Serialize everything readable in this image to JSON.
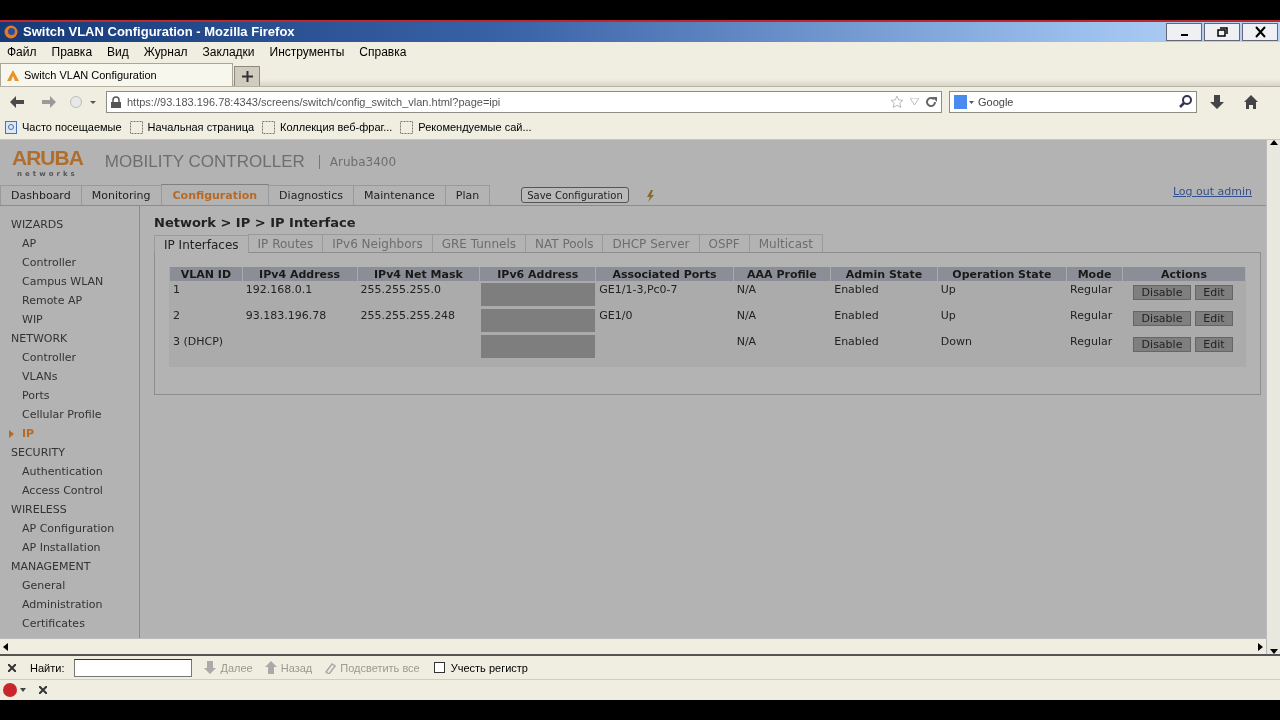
{
  "window": {
    "title": "Switch VLAN Configuration - Mozilla Firefox"
  },
  "menu_bar": [
    "Файл",
    "Правка",
    "Вид",
    "Журнал",
    "Закладки",
    "Инструменты",
    "Справка"
  ],
  "browser_tabs": [
    {
      "label": "Switch VLAN Configuration",
      "selected": true
    }
  ],
  "address_bar": {
    "url": "https://93.183.196.78:4343/screens/switch/config_switch_vlan.html?page=ipi"
  },
  "search_bar": {
    "placeholder": "Google"
  },
  "bookmarks": [
    "Часто посещаемые",
    "Начальная страница",
    "Коллекция веб-фраг...",
    "Рекомендуемые сай..."
  ],
  "app": {
    "logo": "ARUBA",
    "logo_tagline": "networks",
    "product": "MOBILITY CONTROLLER",
    "device": "Aruba3400",
    "nav_tabs": [
      {
        "label": "Dashboard",
        "selected": false
      },
      {
        "label": "Monitoring",
        "selected": false
      },
      {
        "label": "Configuration",
        "selected": true
      },
      {
        "label": "Diagnostics",
        "selected": false
      },
      {
        "label": "Maintenance",
        "selected": false
      },
      {
        "label": "Plan",
        "selected": false
      }
    ],
    "save_button": "Save Configuration",
    "logout_link": "Log out admin",
    "sidebar": {
      "sections": [
        {
          "title": "WIZARDS",
          "items": [
            {
              "label": "AP",
              "selected": false
            },
            {
              "label": "Controller",
              "selected": false
            },
            {
              "label": "Campus WLAN",
              "selected": false
            },
            {
              "label": "Remote AP",
              "selected": false
            },
            {
              "label": "WIP",
              "selected": false
            }
          ]
        },
        {
          "title": "NETWORK",
          "items": [
            {
              "label": "Controller",
              "selected": false
            },
            {
              "label": "VLANs",
              "selected": false
            },
            {
              "label": "Ports",
              "selected": false
            },
            {
              "label": "Cellular Profile",
              "selected": false
            },
            {
              "label": "IP",
              "selected": true
            }
          ]
        },
        {
          "title": "SECURITY",
          "items": [
            {
              "label": "Authentication",
              "selected": false
            },
            {
              "label": "Access Control",
              "selected": false
            }
          ]
        },
        {
          "title": "WIRELESS",
          "items": [
            {
              "label": "AP Configuration",
              "selected": false
            },
            {
              "label": "AP Installation",
              "selected": false
            }
          ]
        },
        {
          "title": "MANAGEMENT",
          "items": [
            {
              "label": "General",
              "selected": false
            },
            {
              "label": "Administration",
              "selected": false
            },
            {
              "label": "Certificates",
              "selected": false
            }
          ]
        }
      ]
    },
    "breadcrumb": "Network > IP > IP Interface",
    "sub_tabs": [
      {
        "label": "IP Interfaces",
        "selected": true
      },
      {
        "label": "IP Routes",
        "selected": false
      },
      {
        "label": "IPv6 Neighbors",
        "selected": false
      },
      {
        "label": "GRE Tunnels",
        "selected": false
      },
      {
        "label": "NAT Pools",
        "selected": false
      },
      {
        "label": "DHCP Server",
        "selected": false
      },
      {
        "label": "OSPF",
        "selected": false
      },
      {
        "label": "Multicast",
        "selected": false
      }
    ],
    "table": {
      "columns": [
        "VLAN ID",
        "IPv4 Address",
        "IPv4 Net Mask",
        "IPv6 Address",
        "Associated Ports",
        "AAA Profile",
        "Admin State",
        "Operation State",
        "Mode",
        "Actions"
      ],
      "rows": [
        {
          "vlan_id": "1",
          "ipv4_address": "192.168.0.1",
          "ipv4_net_mask": "255.255.255.0",
          "associated_ports": "GE1/1-3,Pc0-7",
          "aaa_profile": "N/A",
          "admin_state": "Enabled",
          "operation_state": "Up",
          "mode": "Regular",
          "actions": [
            "Disable",
            "Edit"
          ]
        },
        {
          "vlan_id": "2",
          "ipv4_address": "93.183.196.78",
          "ipv4_net_mask": "255.255.255.248",
          "associated_ports": "GE1/0",
          "aaa_profile": "N/A",
          "admin_state": "Enabled",
          "operation_state": "Up",
          "mode": "Regular",
          "actions": [
            "Disable",
            "Edit"
          ]
        },
        {
          "vlan_id": "3 (DHCP)",
          "aaa_profile": "N/A",
          "admin_state": "Enabled",
          "operation_state": "Down",
          "mode": "Regular",
          "actions": [
            "Disable",
            "Edit"
          ]
        }
      ]
    }
  },
  "find_bar": {
    "label": "Найти:",
    "next": "Далее",
    "previous": "Назад",
    "highlight_all": "Подсветить все",
    "match_case": {
      "label": "Учесть регистр",
      "checked": false
    }
  }
}
